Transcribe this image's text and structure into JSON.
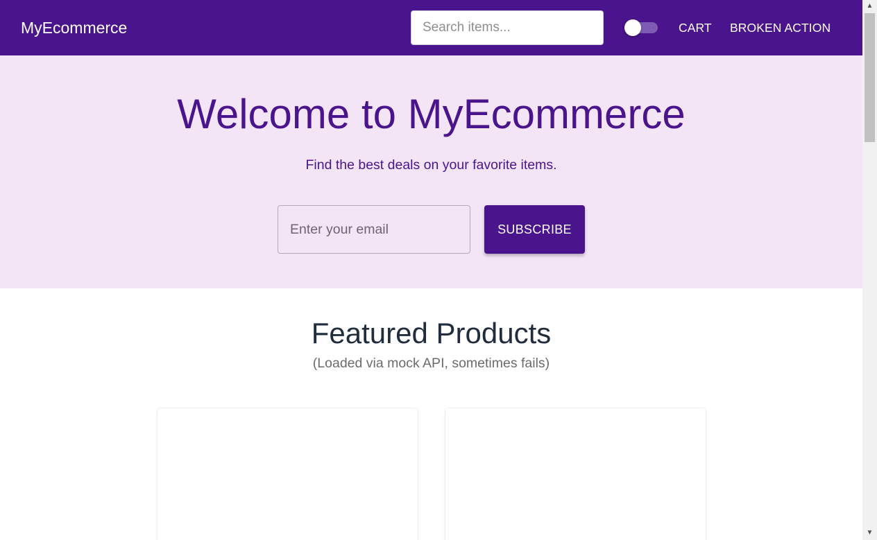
{
  "header": {
    "brand": "MyEcommerce",
    "search_placeholder": "Search items...",
    "search_value": "",
    "theme_toggle": {
      "checked": false
    },
    "nav": [
      {
        "label": "CART"
      },
      {
        "label": "BROKEN ACTION"
      }
    ]
  },
  "hero": {
    "title": "Welcome to MyEcommerce",
    "subtitle": "Find the best deals on your favorite items.",
    "email_placeholder": "Enter your email",
    "email_value": "",
    "subscribe_label": "SUBSCRIBE"
  },
  "featured": {
    "title": "Featured Products",
    "subtitle": "(Loaded via mock API, sometimes fails)"
  },
  "scrollbar": {
    "up_icon": "triangle-up",
    "down_icon": "triangle-down"
  },
  "colors": {
    "primary": "#4a148c",
    "hero_background": "#f3e5f5",
    "heading_dark": "#1f2d3d"
  }
}
